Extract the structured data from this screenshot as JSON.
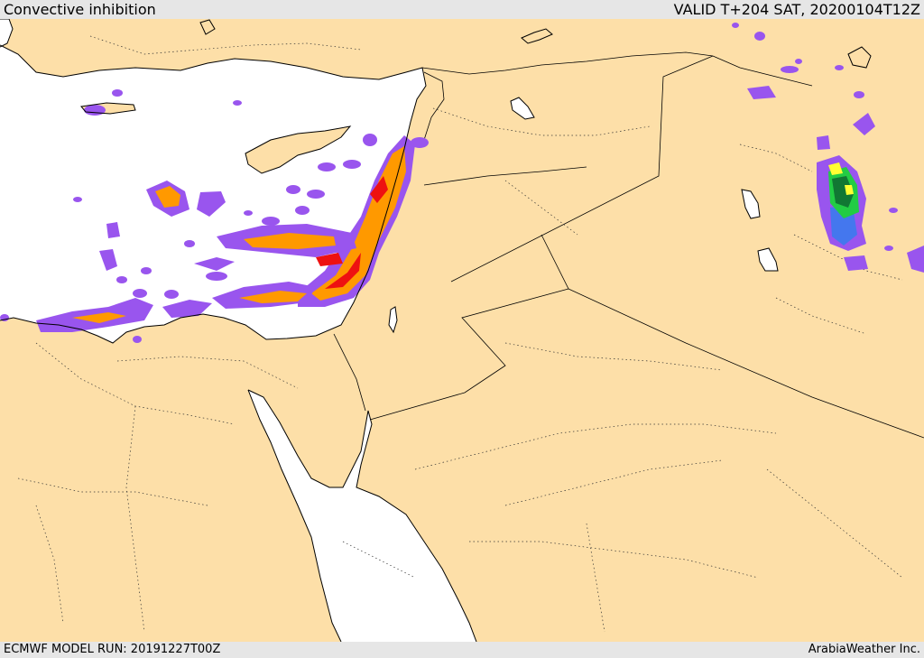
{
  "header": {
    "title": "Convective inhibition",
    "valid_time": "VALID T+204 SAT, 20200104T12Z"
  },
  "footer": {
    "model_run": "ECMWF MODEL RUN: 20191227T00Z",
    "credit": "ArabiaWeather Inc."
  },
  "map": {
    "colors": {
      "land": "#fddfa8",
      "water": "#ffffff",
      "coast": "#000000",
      "purple": "#9955ee",
      "blue": "#4477ee",
      "green": "#22cc44",
      "dark_green": "#117733",
      "yellow": "#ffff33",
      "orange": "#ff9900",
      "red": "#ee1111"
    }
  }
}
